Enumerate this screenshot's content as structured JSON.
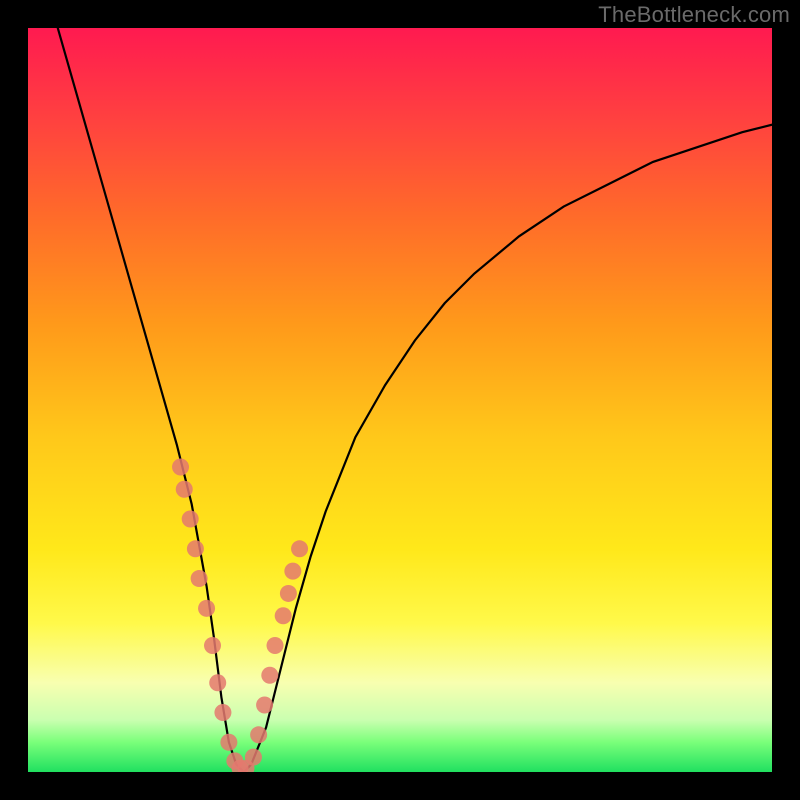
{
  "watermark": "TheBottleneck.com",
  "chart_data": {
    "type": "line",
    "title": "",
    "xlabel": "",
    "ylabel": "",
    "xlim": [
      0,
      100
    ],
    "ylim": [
      0,
      100
    ],
    "curve": {
      "x": [
        4,
        6,
        8,
        10,
        12,
        14,
        16,
        18,
        20,
        22,
        24,
        25,
        26,
        27,
        28,
        29,
        30,
        32,
        34,
        36,
        38,
        40,
        44,
        48,
        52,
        56,
        60,
        66,
        72,
        78,
        84,
        90,
        96,
        100
      ],
      "y": [
        100,
        93,
        86,
        79,
        72,
        65,
        58,
        51,
        44,
        36,
        25,
        18,
        10,
        4,
        1,
        0,
        1,
        6,
        14,
        22,
        29,
        35,
        45,
        52,
        58,
        63,
        67,
        72,
        76,
        79,
        82,
        84,
        86,
        87
      ]
    },
    "markers": {
      "x": [
        20.5,
        21.0,
        21.8,
        22.5,
        23.0,
        24.0,
        24.8,
        25.5,
        26.2,
        27.0,
        27.8,
        28.5,
        29.3,
        30.3,
        31.0,
        31.8,
        32.5,
        33.2,
        34.3,
        35.0,
        35.6,
        36.5
      ],
      "y": [
        41.0,
        38.0,
        34.0,
        30.0,
        26.0,
        22.0,
        17.0,
        12.0,
        8.0,
        4.0,
        1.5,
        0.5,
        0.5,
        2.0,
        5.0,
        9.0,
        13.0,
        17.0,
        21.0,
        24.0,
        27.0,
        30.0
      ]
    }
  }
}
